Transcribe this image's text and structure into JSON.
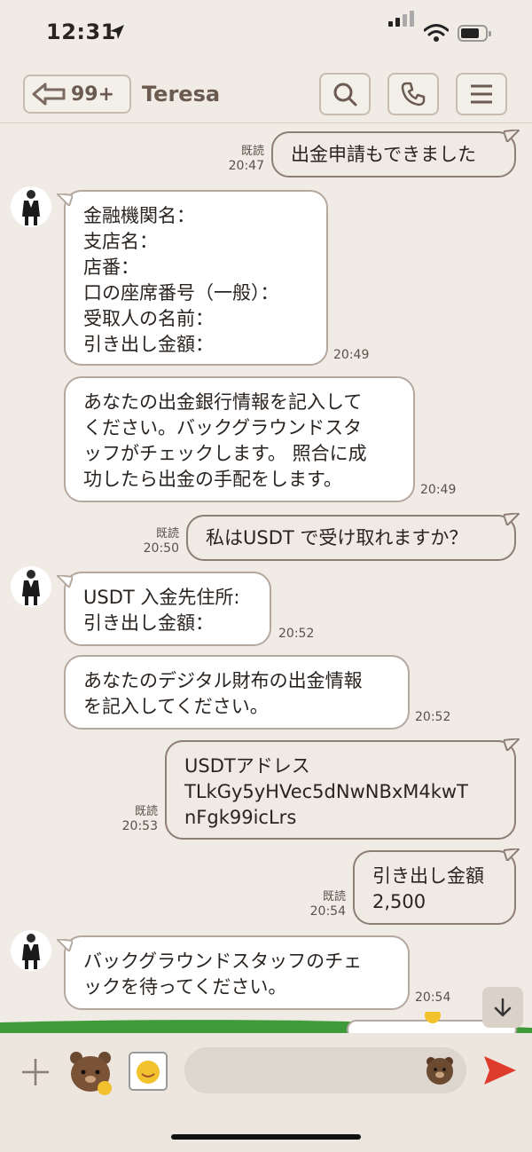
{
  "status_bar": {
    "time": "12:31"
  },
  "header": {
    "back_count": "99+",
    "title": "Teresa"
  },
  "messages": [
    {
      "side": "me",
      "text": "出金申請もできました",
      "read": "既読",
      "time": "20:47"
    },
    {
      "side": "them",
      "text": "金融機関名：\n支店名：\n店番：\n口の座席番号（一般）：\n受取人の名前：\n引き出し金額：",
      "time": "20:49"
    },
    {
      "side": "them",
      "text": "あなたの出金銀行情報を記入して\nください。バックグラウンドスタ\nッフがチェックします。 照合に成\n功したら出金の手配をします。",
      "time": "20:49"
    },
    {
      "side": "me",
      "text": "私はUSDT で受け取れますか？",
      "read": "既読",
      "time": "20:50"
    },
    {
      "side": "them",
      "text": "USDT 入金先住所:\n引き出し金額：",
      "time": "20:52"
    },
    {
      "side": "them",
      "text": "あなたのデジタル財布の出金情報\nを記入してください。",
      "time": "20:52"
    },
    {
      "side": "me",
      "text": "USDTアドレス\nTLkGy5yHVec5dNwNBxM4kwT\nnFgk99icLrs",
      "read": "既読",
      "time": "20:53"
    },
    {
      "side": "me",
      "text": "引き出し金額\n2,500",
      "read": "既読",
      "time": "20:54"
    },
    {
      "side": "them",
      "text": "バックグラウンドスタッフのチェ\nックを待ってください。",
      "time": "20:54"
    }
  ],
  "icons": {
    "back": "back-arrow-icon",
    "search": "search-icon",
    "call": "phone-icon",
    "menu": "menu-icon",
    "plus": "plus-icon",
    "sticker": "sticker-icon",
    "emoji": "bear-emoji-icon",
    "send": "send-icon",
    "scroll": "arrow-down-icon"
  },
  "colors": {
    "background": "#f0ebe5",
    "send": "#e03c2e",
    "bubble_me": "#efeae4",
    "bubble_them": "#ffffff"
  }
}
